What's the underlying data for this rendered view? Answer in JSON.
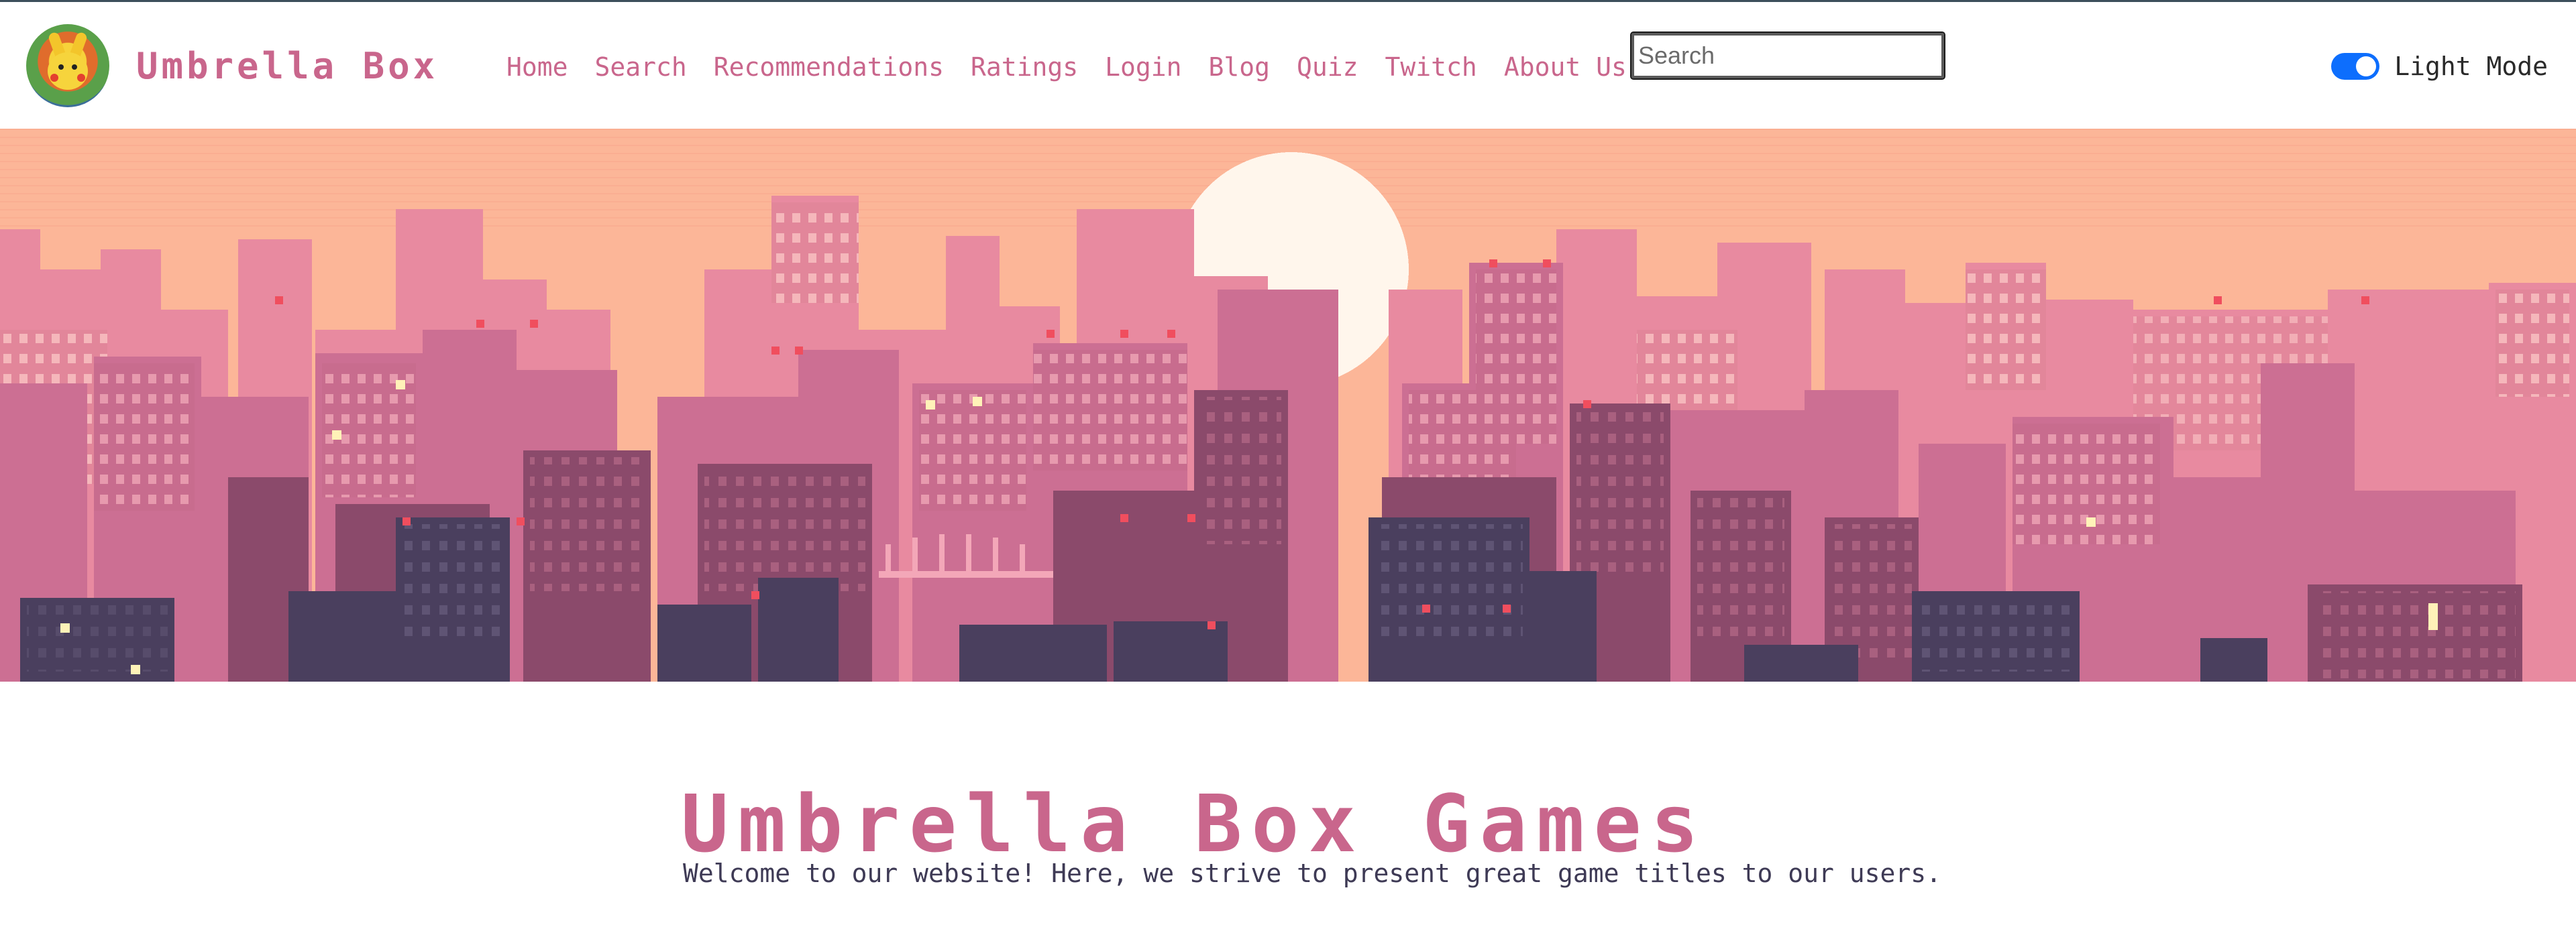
{
  "brand": {
    "name": "Umbrella Box",
    "logo_icon": "pikachu-avatar-icon"
  },
  "nav": {
    "links": [
      "Home",
      "Search",
      "Recommendations",
      "Ratings",
      "Login",
      "Blog",
      "Quiz",
      "Twitch",
      "About Us"
    ]
  },
  "search": {
    "placeholder": "Search",
    "value": ""
  },
  "theme_toggle": {
    "label": "Light Mode",
    "checked": true
  },
  "hero": {
    "image": "pixel-art-city-skyline-sunset"
  },
  "main": {
    "title": "Umbrella Box Games",
    "welcome": "Welcome to our website! Here, we strive to present great game titles to our users."
  },
  "colors": {
    "accent": "#c9668c",
    "toggle_on": "#0d6efd",
    "sky": "#fcb698",
    "text_dark": "#3e3a55"
  }
}
